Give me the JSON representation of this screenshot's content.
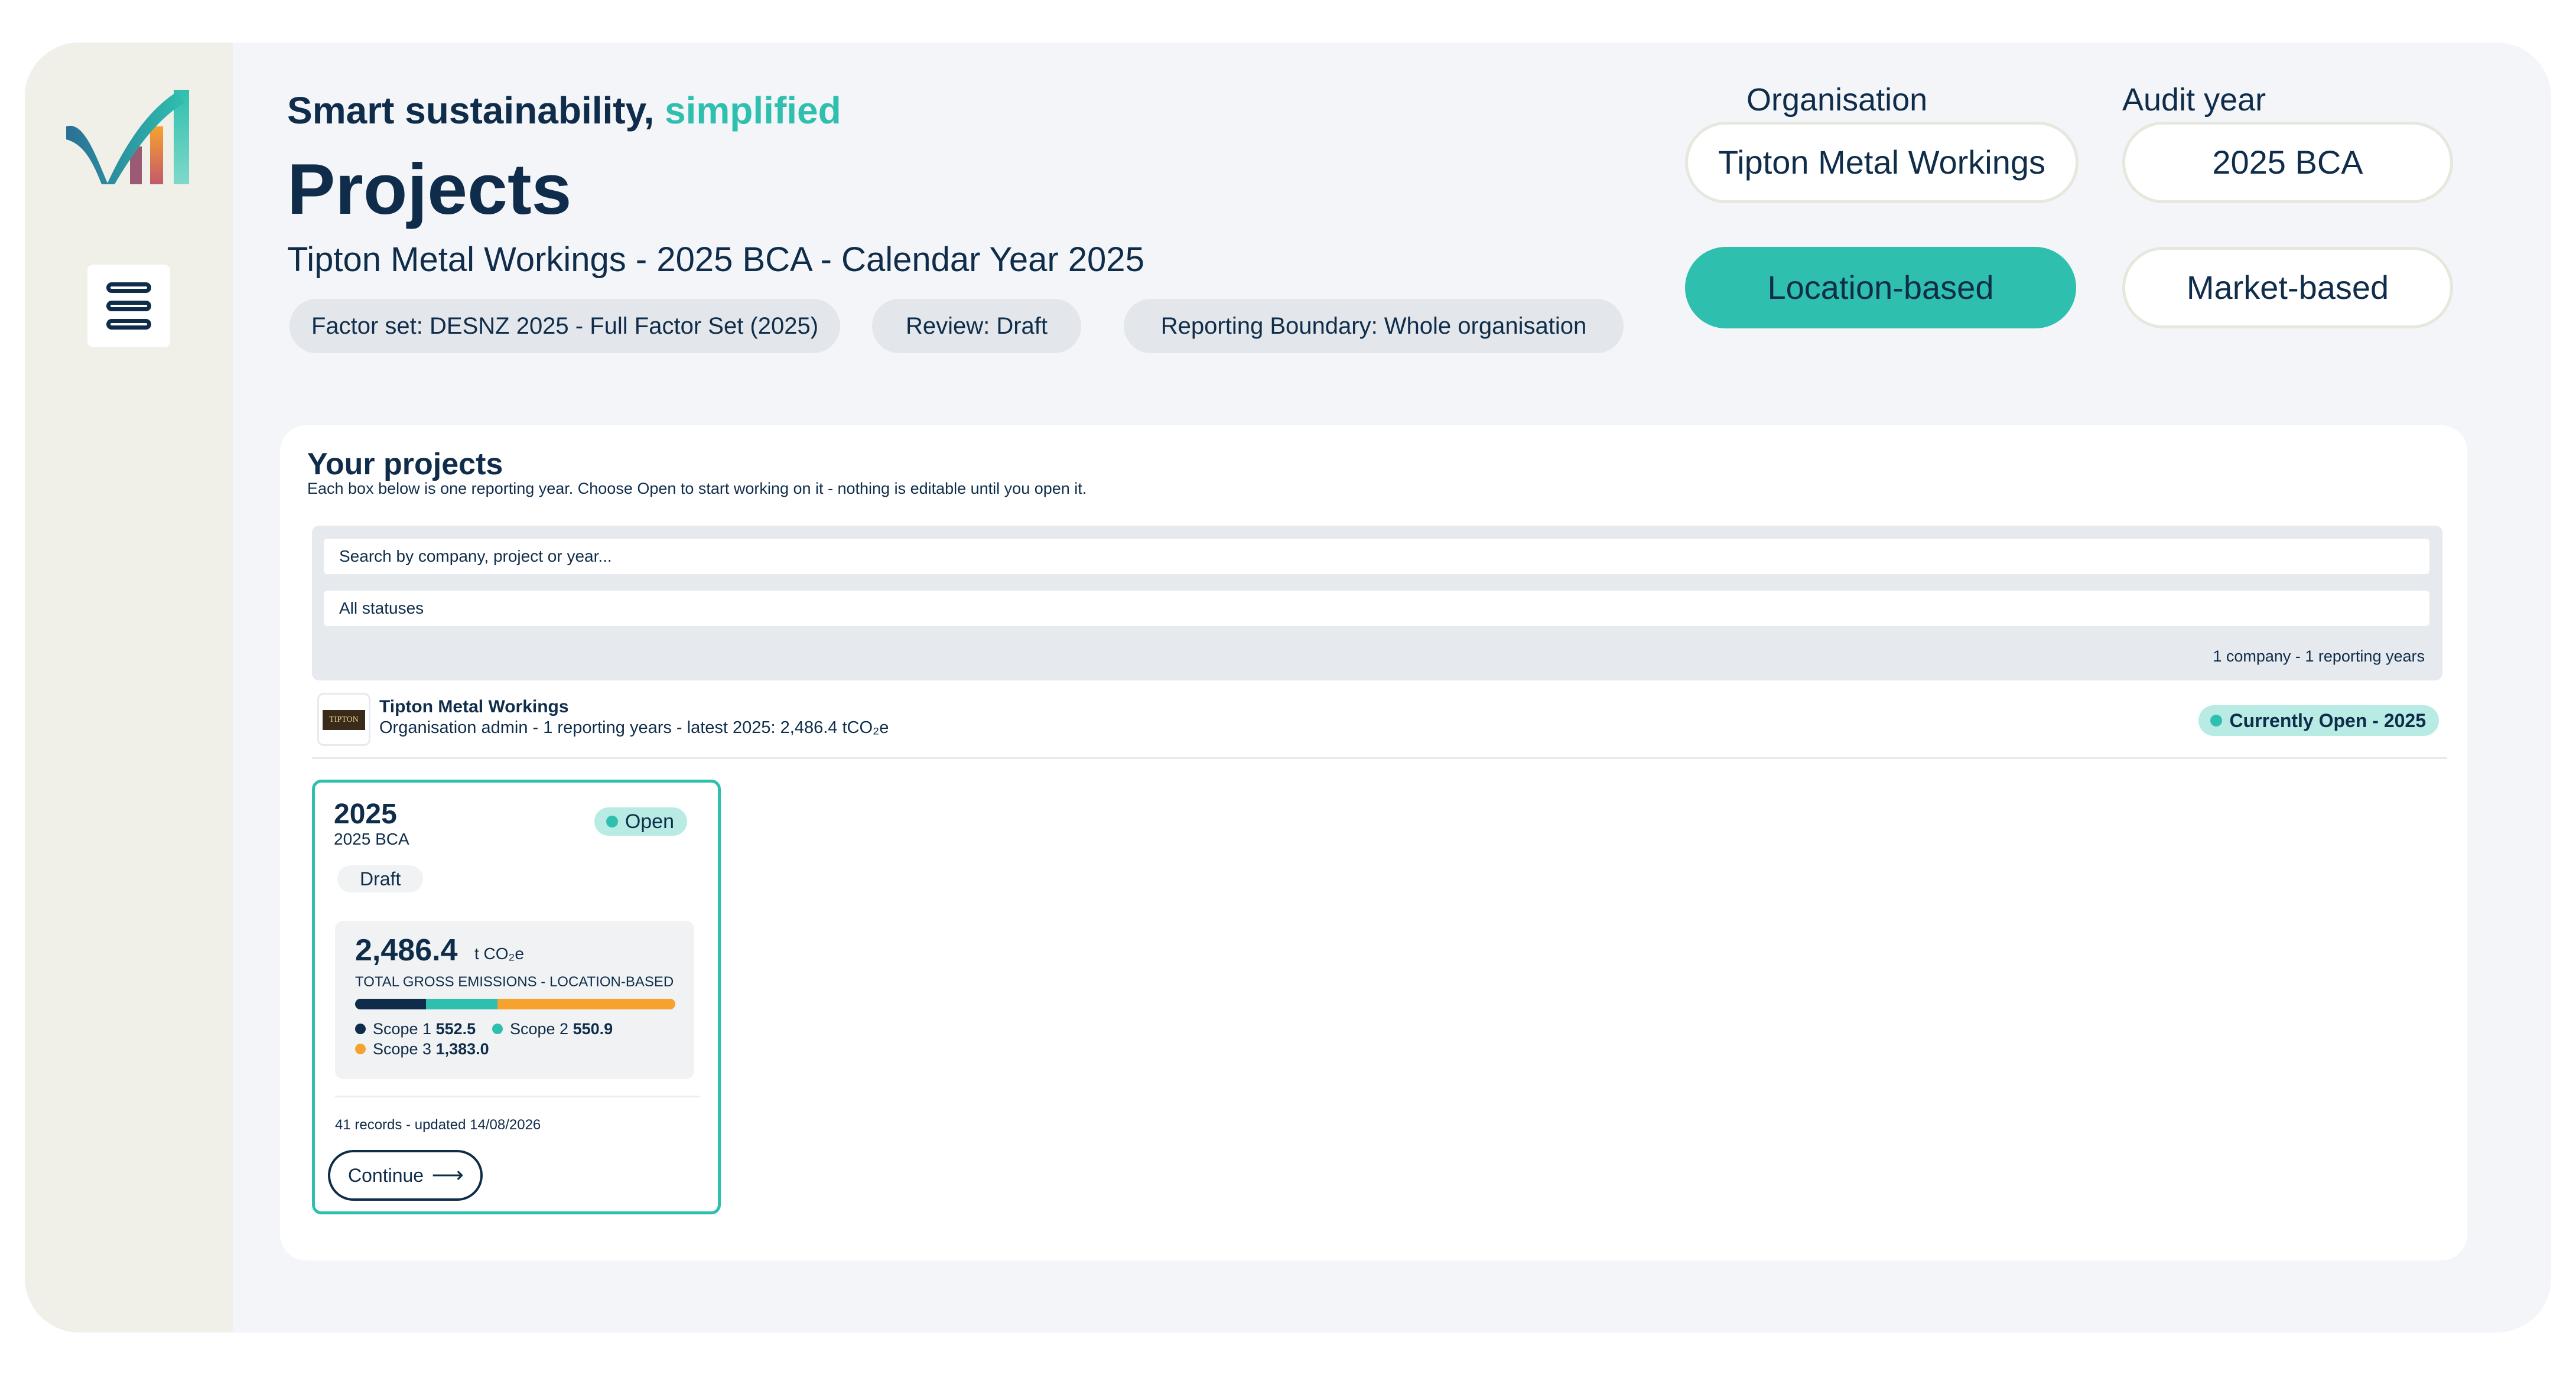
{
  "header": {
    "tagline_main": "Smart sustainability,",
    "tagline_accent": "simplified",
    "title": "Projects",
    "subtitle": "Tipton Metal Workings - 2025 BCA - Calendar Year 2025",
    "chips": {
      "factor_set": "Factor set: DESNZ 2025 - Full Factor Set (2025)",
      "review": "Review: Draft",
      "boundary": "Reporting Boundary: Whole organisation"
    }
  },
  "controls": {
    "organisation_label": "Organisation",
    "organisation_value": "Tipton Metal Workings",
    "audit_year_label": "Audit year",
    "audit_year_value": "2025 BCA",
    "location_based": "Location-based",
    "market_based": "Market-based",
    "active_basis": "location"
  },
  "projects": {
    "title": "Your projects",
    "description": "Each box below is one reporting year. Choose Open to start working on it - nothing is editable until you open it.",
    "search_placeholder": "Search by company, project or year...",
    "status_filter": "All statuses",
    "count_text": "1 company - 1 reporting years",
    "company": {
      "logo_text": "TIPTON",
      "name": "Tipton Metal Workings",
      "meta": "Organisation admin - 1 reporting years - latest 2025: 2,486.4 tCO₂e",
      "status": "Currently Open - 2025"
    },
    "card": {
      "year": "2025",
      "subtitle": "2025 BCA",
      "badge": "Open",
      "review_state": "Draft",
      "total_value": "2,486.4",
      "total_unit": "t CO₂e",
      "total_caption": "TOTAL GROSS EMISSIONS - LOCATION-BASED",
      "scopes": [
        {
          "label": "Scope 1",
          "value": "552.5",
          "amount": 552.5,
          "color": "#0f2d4a"
        },
        {
          "label": "Scope 2",
          "value": "550.9",
          "amount": 550.9,
          "color": "#2fbfae"
        },
        {
          "label": "Scope 3",
          "value": "1,383.0",
          "amount": 1383.0,
          "color": "#f7a12f"
        }
      ],
      "records": "41 records - updated 14/08/2026",
      "continue_label": "Continue",
      "continue_arrow": "⟶"
    }
  },
  "colors": {
    "brand_navy": "#0f2d4a",
    "brand_teal": "#2fbfae",
    "accent_orange": "#f7a12f",
    "sidebar_bg": "#f0f0e9"
  },
  "icons": {
    "logo": "brand-logo",
    "menu": "database-stack-icon"
  }
}
